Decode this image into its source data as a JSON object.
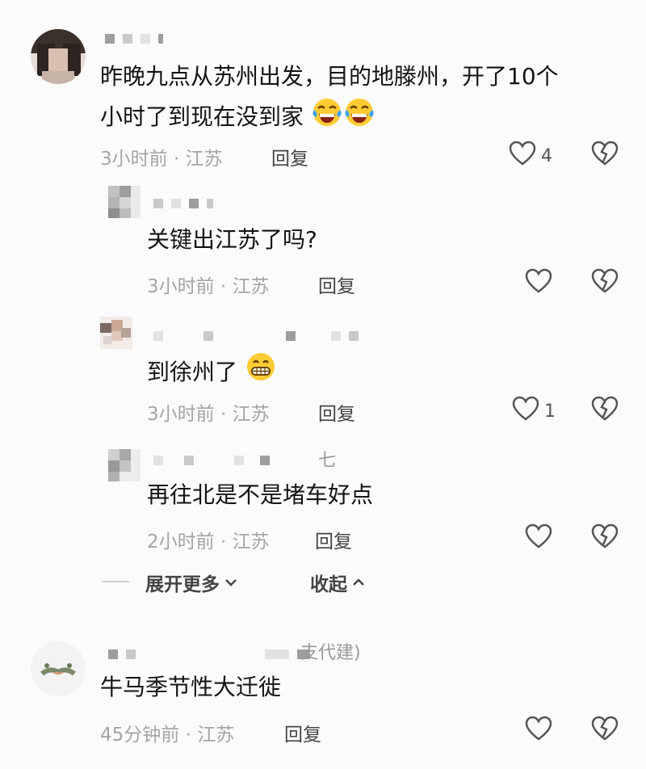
{
  "comments": [
    {
      "text_line1": "昨晚九点从苏州出发，目的地滕州，开了10个",
      "text_line2": "小时了到现在没到家",
      "emojis": [
        "crying-laughing-emoji",
        "crying-laughing-emoji"
      ],
      "time": "3小时前 · 江苏",
      "reply_label": "回复",
      "likes": "4"
    }
  ],
  "replies": [
    {
      "text": "关键出江苏了吗?",
      "time": "3小时前 · 江苏",
      "reply_label": "回复",
      "likes": ""
    },
    {
      "text": "到徐州了",
      "emoji": "grinning-emoji",
      "time": "3小时前 · 江苏",
      "reply_label": "回复",
      "likes": "1"
    },
    {
      "name_suffix": "七",
      "text": "再往北是不是堵车好点",
      "time": "2小时前 · 江苏",
      "reply_label": "回复",
      "likes": ""
    }
  ],
  "thread_controls": {
    "expand_label": "展开更多",
    "collapse_label": "收起"
  },
  "comment2": {
    "name_suffix": "支代建)",
    "text": "牛马季节性大迁徙",
    "time": "45分钟前 · 江苏",
    "reply_label": "回复",
    "likes": ""
  },
  "icons": {
    "like": "heart-outline-icon",
    "dislike": "broken-heart-icon"
  },
  "colors": {
    "meta": "#a5a5a5",
    "background": "#fbfbfb",
    "emoji_yellow": "#ffcc33"
  }
}
